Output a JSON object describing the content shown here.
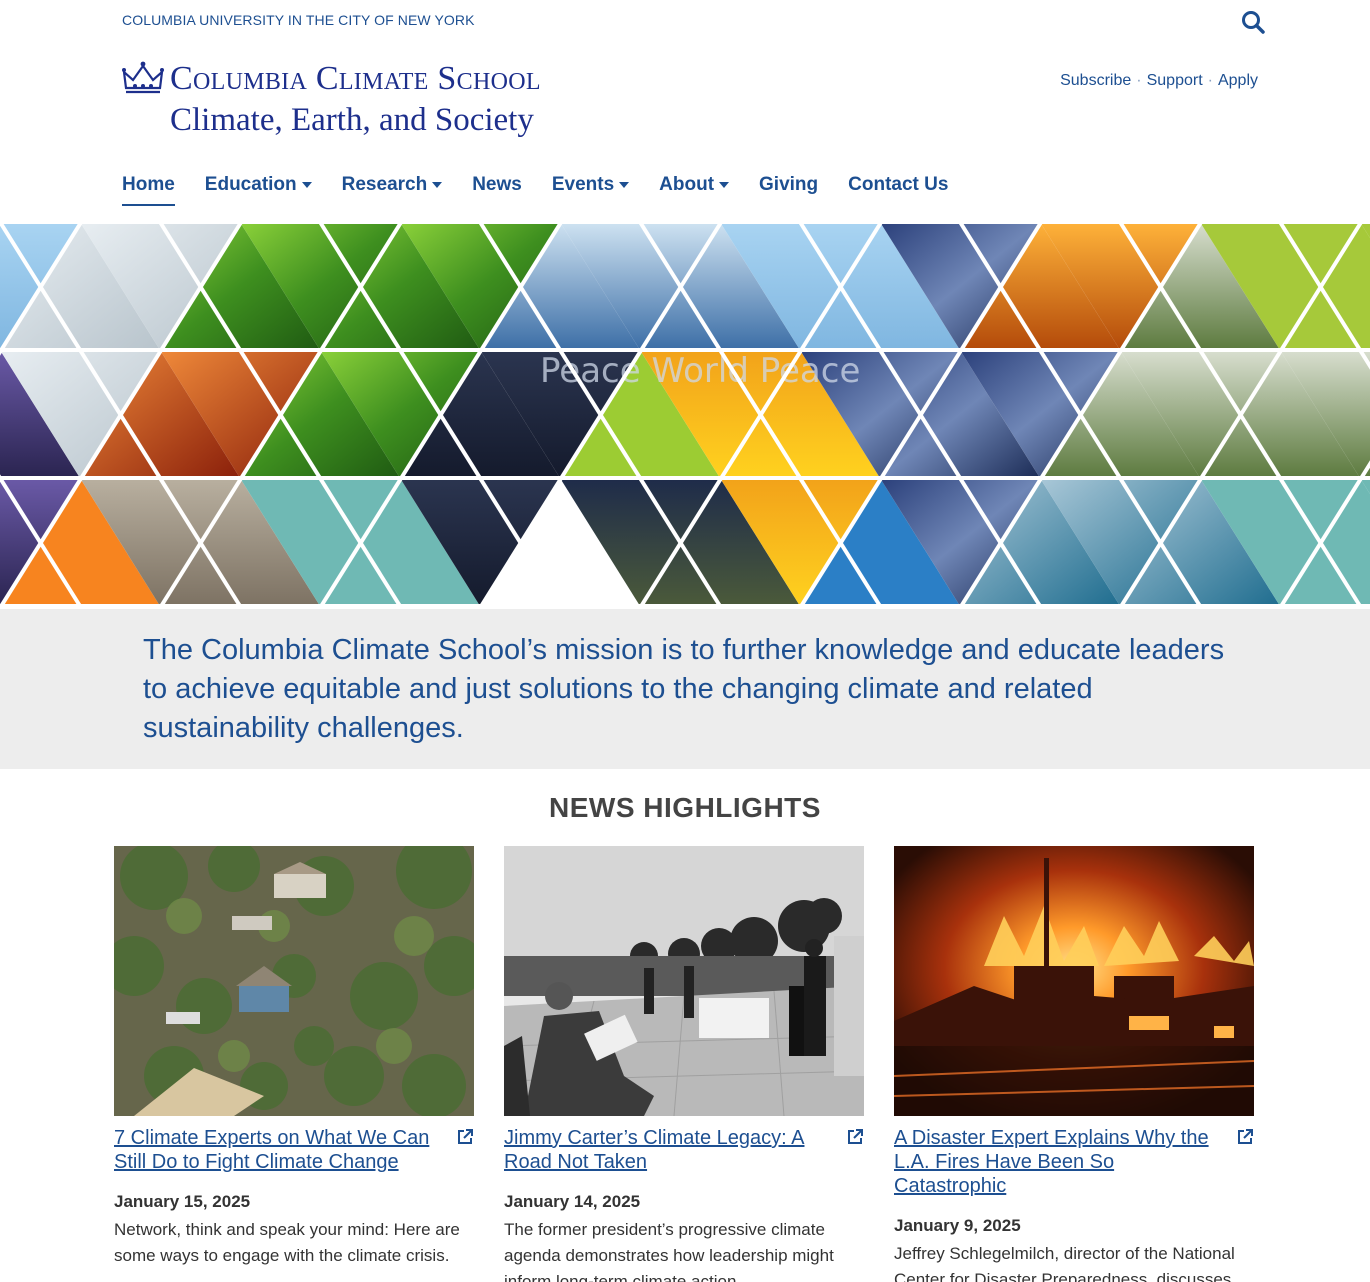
{
  "topbar": {
    "university": "COLUMBIA UNIVERSITY IN THE CITY OF NEW YORK",
    "search_icon": "search-icon"
  },
  "brand": {
    "title": "Columbia Climate School",
    "subtitle": "Climate, Earth, and Society",
    "logo_icon": "crown-icon"
  },
  "utility_links": {
    "subscribe": "Subscribe",
    "support": "Support",
    "apply": "Apply",
    "separator": "·"
  },
  "nav": {
    "items": [
      {
        "label": "Home",
        "active": true,
        "dropdown": false
      },
      {
        "label": "Education",
        "active": false,
        "dropdown": true
      },
      {
        "label": "Research",
        "active": false,
        "dropdown": true
      },
      {
        "label": "News",
        "active": false,
        "dropdown": false
      },
      {
        "label": "Events",
        "active": false,
        "dropdown": true
      },
      {
        "label": "About",
        "active": false,
        "dropdown": true
      },
      {
        "label": "Giving",
        "active": false,
        "dropdown": false
      },
      {
        "label": "Contact Us",
        "active": false,
        "dropdown": false
      }
    ]
  },
  "hero": {
    "collage_text": "Peace World Peace"
  },
  "mission": {
    "text": "The Columbia Climate School’s mission is to further knowledge and educate leaders to achieve equitable and just solutions to the changing climate and related sustainability challenges."
  },
  "news": {
    "heading": "NEWS HIGHLIGHTS",
    "cards": [
      {
        "title": "7 Climate Experts on What We Can Still Do to Fight Climate Change",
        "date": "January 15, 2025",
        "excerpt": "Network, think and speak your mind: Here are some ways to engage with the climate crisis."
      },
      {
        "title": "Jimmy Carter’s Climate Legacy: A Road Not Taken",
        "date": "January 14, 2025",
        "excerpt": "The former president’s progressive climate agenda demonstrates how leadership might inform long-term climate action."
      },
      {
        "title": "A Disaster Expert Explains Why the L.A. Fires Have Been So Catastrophic",
        "date": "January 9, 2025",
        "excerpt": "Jeffrey Schlegelmilch, director of the National Center for Disaster Preparedness, discusses"
      }
    ]
  },
  "colors": {
    "brand_blue": "#1d4f91",
    "logo_navy": "#1d2f8c",
    "band_gray": "#ededed"
  }
}
